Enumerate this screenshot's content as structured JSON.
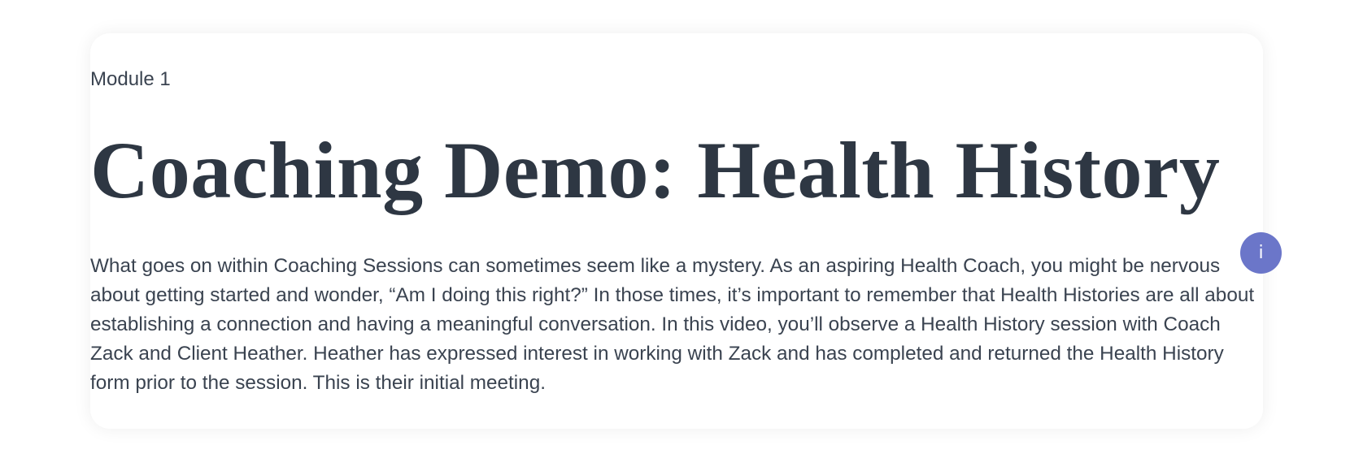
{
  "module": {
    "label": "Module 1"
  },
  "lesson": {
    "title": "Coaching Demo: Health History",
    "description": "What goes on within Coaching Sessions can sometimes seem like a mystery. As an aspiring Health Coach, you might be nervous about getting started and wonder, “Am I doing this right?”  In those times, it’s important to remember that Health Histories are all about establishing a connection and having a meaningful conversation. In this video, you’ll observe a Health History session with Coach Zack and Client Heather. Heather has expressed interest in working with Zack and has completed and returned the Health History form prior to the session. This is their initial meeting."
  },
  "info_button": {
    "label": "i",
    "icon": "info-icon",
    "color": "#6b76c9"
  },
  "colors": {
    "text": "#2e3743",
    "card_background": "#ffffff"
  }
}
